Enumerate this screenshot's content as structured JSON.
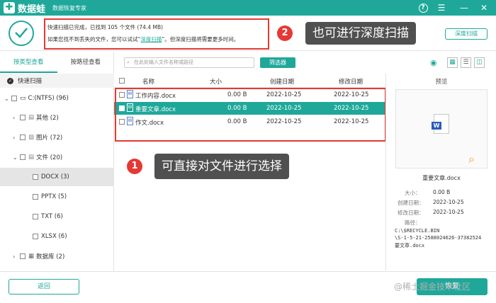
{
  "titlebar": {
    "app_name": "数据蛙",
    "subtitle": "数据恢复专家"
  },
  "header": {
    "status_line1": "快速扫描已完成，已找到 105 个文件 (74.4 MB)",
    "status_line2_prefix": "如果您找不到丢失的文件，您可以试试“",
    "deep_scan_link": "深度扫描",
    "status_line2_suffix": "”。但深度扫描将需要更多时间。",
    "deep_scan_button": "深度扫描"
  },
  "callouts": {
    "badge1": "1",
    "text1": "可直接对文件进行选择",
    "badge2": "2",
    "text2": "也可进行深度扫描"
  },
  "left": {
    "tab_type": "按类型查看",
    "tab_path": "按路径查看",
    "quick_scan": "快速扫描",
    "tree": {
      "drive": "C:(NTFS) (96)",
      "other": "其他 (2)",
      "images": "图片 (72)",
      "docs": "文件 (20)",
      "docx": "DOCX (3)",
      "pptx": "PPTX (5)",
      "txt": "TXT (6)",
      "xlsx": "XLSX (6)",
      "db": "数据库 (2)"
    }
  },
  "toolbar": {
    "search_placeholder": "在此处输入文件名称或路径",
    "filter_button": "筛选器"
  },
  "table": {
    "headers": {
      "name": "名称",
      "size": "大小",
      "created": "创建日期",
      "modified": "修改日期"
    },
    "rows": [
      {
        "name": "工作内容.docx",
        "size": "0.00 B",
        "created": "2022-10-25",
        "modified": "2022-10-25"
      },
      {
        "name": "重要文章.docx",
        "size": "0.00 B",
        "created": "2022-10-25",
        "modified": "2022-10-25"
      },
      {
        "name": "作文.docx",
        "size": "0.00 B",
        "created": "2022-10-25",
        "modified": "2022-10-25"
      }
    ]
  },
  "preview": {
    "title": "预览",
    "file_name": "重要文章.docx",
    "size_label": "大小：",
    "size_value": "0.00 B",
    "created_label": "创建日期：",
    "created_value": "2022-10-25",
    "modified_label": "修改日期：",
    "modified_value": "2022-10-25",
    "path_label": "路径：",
    "path_line1": "C:\\$RECYCLE.BIN",
    "path_line2": "\\S-1-5-21-2588024626-37382524",
    "path_line3": "要文章.docx"
  },
  "bottom": {
    "back_button": "返回",
    "recover_button": "恢复"
  },
  "watermark": "@稀土掘金技术社区",
  "colors": {
    "accent": "#1fa89a",
    "highlight": "#e53935",
    "callout": "#505050"
  }
}
